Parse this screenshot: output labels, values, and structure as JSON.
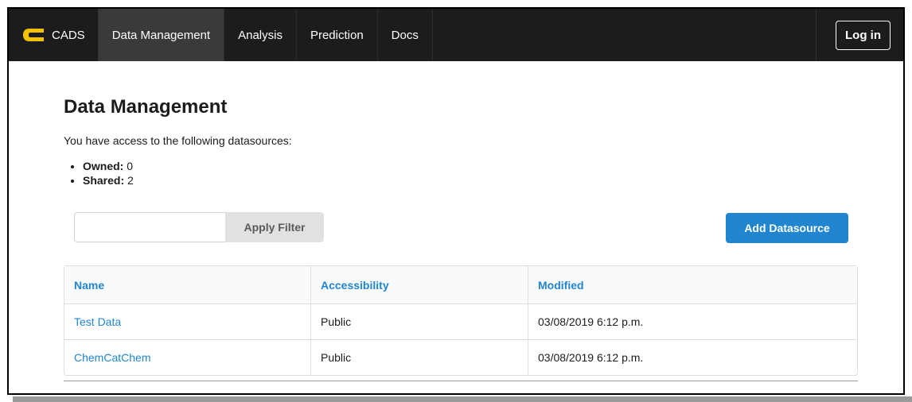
{
  "nav": {
    "brand": "CADS",
    "items": [
      {
        "label": "Data Management",
        "active": true
      },
      {
        "label": "Analysis",
        "active": false
      },
      {
        "label": "Prediction",
        "active": false
      },
      {
        "label": "Docs",
        "active": false
      }
    ],
    "login_label": "Log in"
  },
  "page": {
    "title": "Data Management",
    "intro": "You have access to the following datasources:",
    "owned_label": "Owned:",
    "owned_count": "0",
    "shared_label": "Shared:",
    "shared_count": "2"
  },
  "filter": {
    "value": "",
    "placeholder": "",
    "apply_label": "Apply Filter"
  },
  "add_label": "Add Datasource",
  "table": {
    "headers": [
      "Name",
      "Accessibility",
      "Modified"
    ],
    "rows": [
      [
        "Test Data",
        "Public",
        "03/08/2019 6:12 p.m."
      ],
      [
        "ChemCatChem",
        "Public",
        "03/08/2019 6:12 p.m."
      ]
    ]
  },
  "colors": {
    "navbar": "#1b1c1d",
    "active_tab": "#3a3a3a",
    "primary": "#2185d0",
    "logo": "#f2c200"
  },
  "icons": {
    "brand": "cads-logo-icon"
  }
}
